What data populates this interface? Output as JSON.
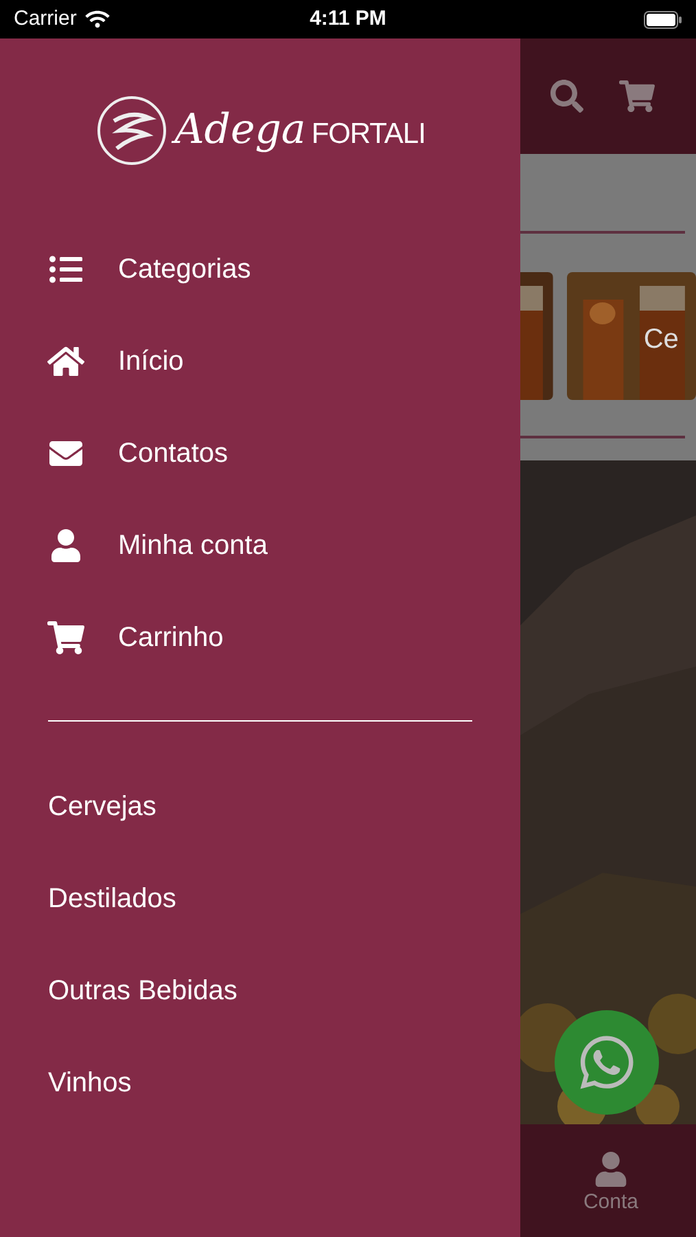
{
  "status_bar": {
    "carrier": "Carrier",
    "time": "4:11 PM"
  },
  "drawer": {
    "brand": {
      "script": "Adega",
      "caps": "FORTALI"
    },
    "menu": [
      {
        "label": "Categorias",
        "kind": "list"
      },
      {
        "label": "Início",
        "kind": "home"
      },
      {
        "label": "Contatos",
        "kind": "mail"
      },
      {
        "label": "Minha conta",
        "kind": "user"
      },
      {
        "label": "Carrinho",
        "kind": "cart"
      }
    ],
    "categories": [
      "Cervejas",
      "Destilados",
      "Outras Bebidas",
      "Vinhos"
    ]
  },
  "page_behind": {
    "category_card_label": "Ce",
    "tab_bar": [
      {
        "label": "Conta",
        "kind": "user"
      }
    ]
  }
}
